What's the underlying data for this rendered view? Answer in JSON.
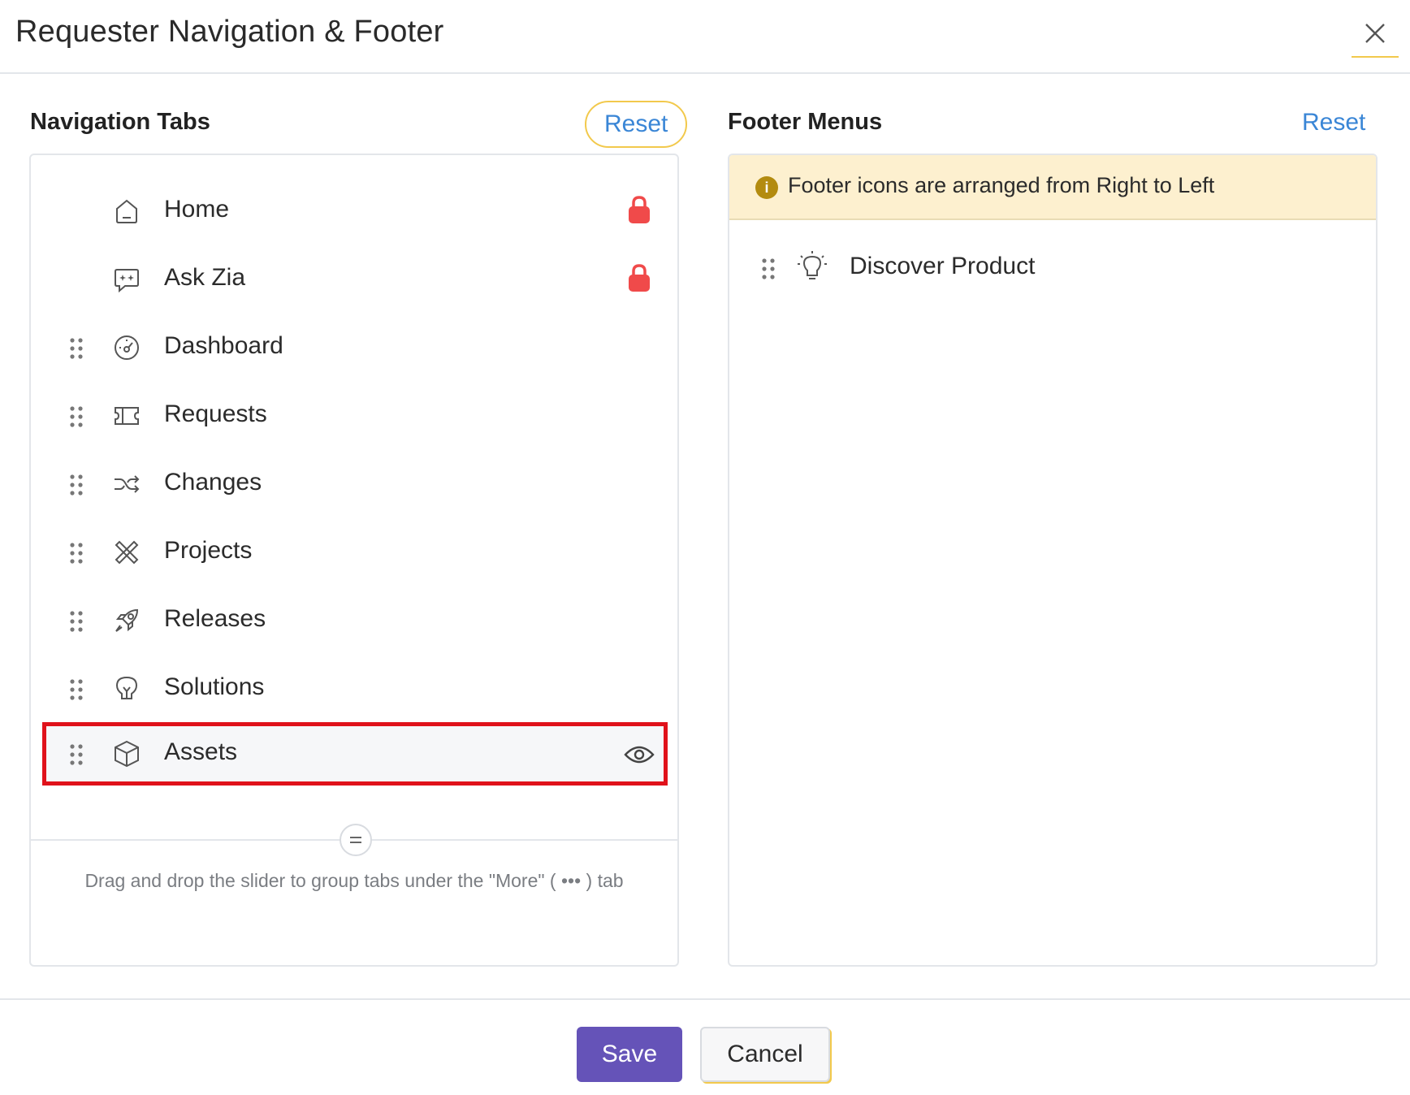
{
  "dialog": {
    "title": "Requester Navigation & Footer",
    "close_icon": "close-icon"
  },
  "navigation": {
    "title": "Navigation Tabs",
    "reset_label": "Reset",
    "tabs": [
      {
        "label": "Home",
        "icon": "home-icon",
        "locked": true
      },
      {
        "label": "Ask Zia",
        "icon": "chat-sparkle-icon",
        "locked": true
      },
      {
        "label": "Dashboard",
        "icon": "gauge-icon",
        "locked": false
      },
      {
        "label": "Requests",
        "icon": "ticket-icon",
        "locked": false
      },
      {
        "label": "Changes",
        "icon": "shuffle-icon",
        "locked": false
      },
      {
        "label": "Projects",
        "icon": "tools-icon",
        "locked": false
      },
      {
        "label": "Releases",
        "icon": "rocket-icon",
        "locked": false
      },
      {
        "label": "Solutions",
        "icon": "bulb-icon",
        "locked": false
      },
      {
        "label": "Assets",
        "icon": "cube-icon",
        "locked": false,
        "highlighted": true
      }
    ],
    "slider_hint": "Drag and drop the slider to group tabs under the \"More\" ( ••• ) tab"
  },
  "footer": {
    "title": "Footer Menus",
    "reset_label": "Reset",
    "info_text": "Footer icons are arranged from Right to Left",
    "items": [
      {
        "label": "Discover Product",
        "icon": "lightbulb-glow-icon"
      }
    ]
  },
  "actions": {
    "save_label": "Save",
    "cancel_label": "Cancel"
  },
  "colors": {
    "accent": "#6553b8",
    "link": "#3a86d6",
    "lock": "#f04a4a",
    "info_bg": "#fdf0cf",
    "highlight_border": "#e0121b"
  }
}
